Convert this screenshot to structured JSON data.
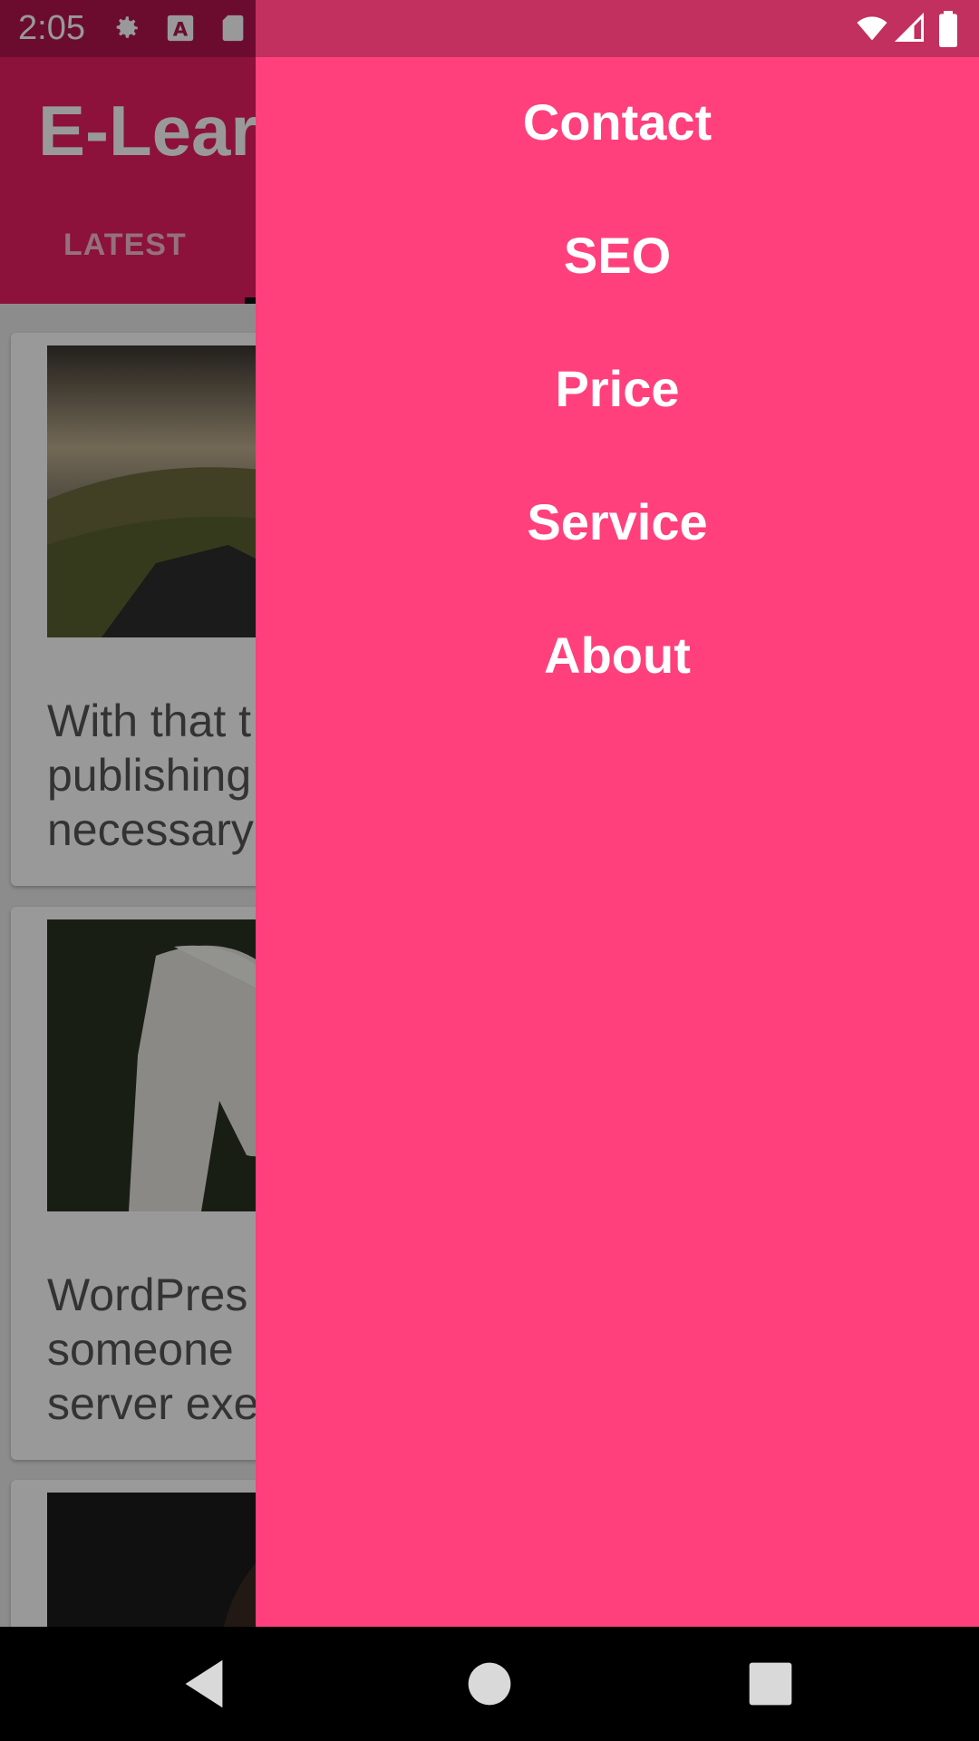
{
  "status_bar": {
    "time": "2:05",
    "icons": [
      "gear-icon",
      "a-icon",
      "sd-card-icon",
      "wifi-icon",
      "signal-icon",
      "battery-icon"
    ]
  },
  "app_bar": {
    "title": "E-Learning",
    "tabs": [
      {
        "label": "LATEST"
      }
    ]
  },
  "cards": [
    {
      "image": "landscape-photo",
      "text": "With that t\npublishing\nnecessary"
    },
    {
      "image": "white-horse-photo",
      "text": "WordPres\nsomeone\nserver exe"
    },
    {
      "image": "portrait-photo",
      "text": ""
    }
  ],
  "drawer": {
    "items": [
      {
        "label": "Contact"
      },
      {
        "label": "SEO"
      },
      {
        "label": "Price"
      },
      {
        "label": "Service"
      },
      {
        "label": "About"
      }
    ]
  },
  "nav_bar": {
    "buttons": [
      "back-icon",
      "home-icon",
      "recents-icon"
    ]
  },
  "colors": {
    "primary": "#e91e63",
    "primary_dark": "#b2154f",
    "drawer": "#ff407d",
    "drawer_text": "#ffffff"
  }
}
